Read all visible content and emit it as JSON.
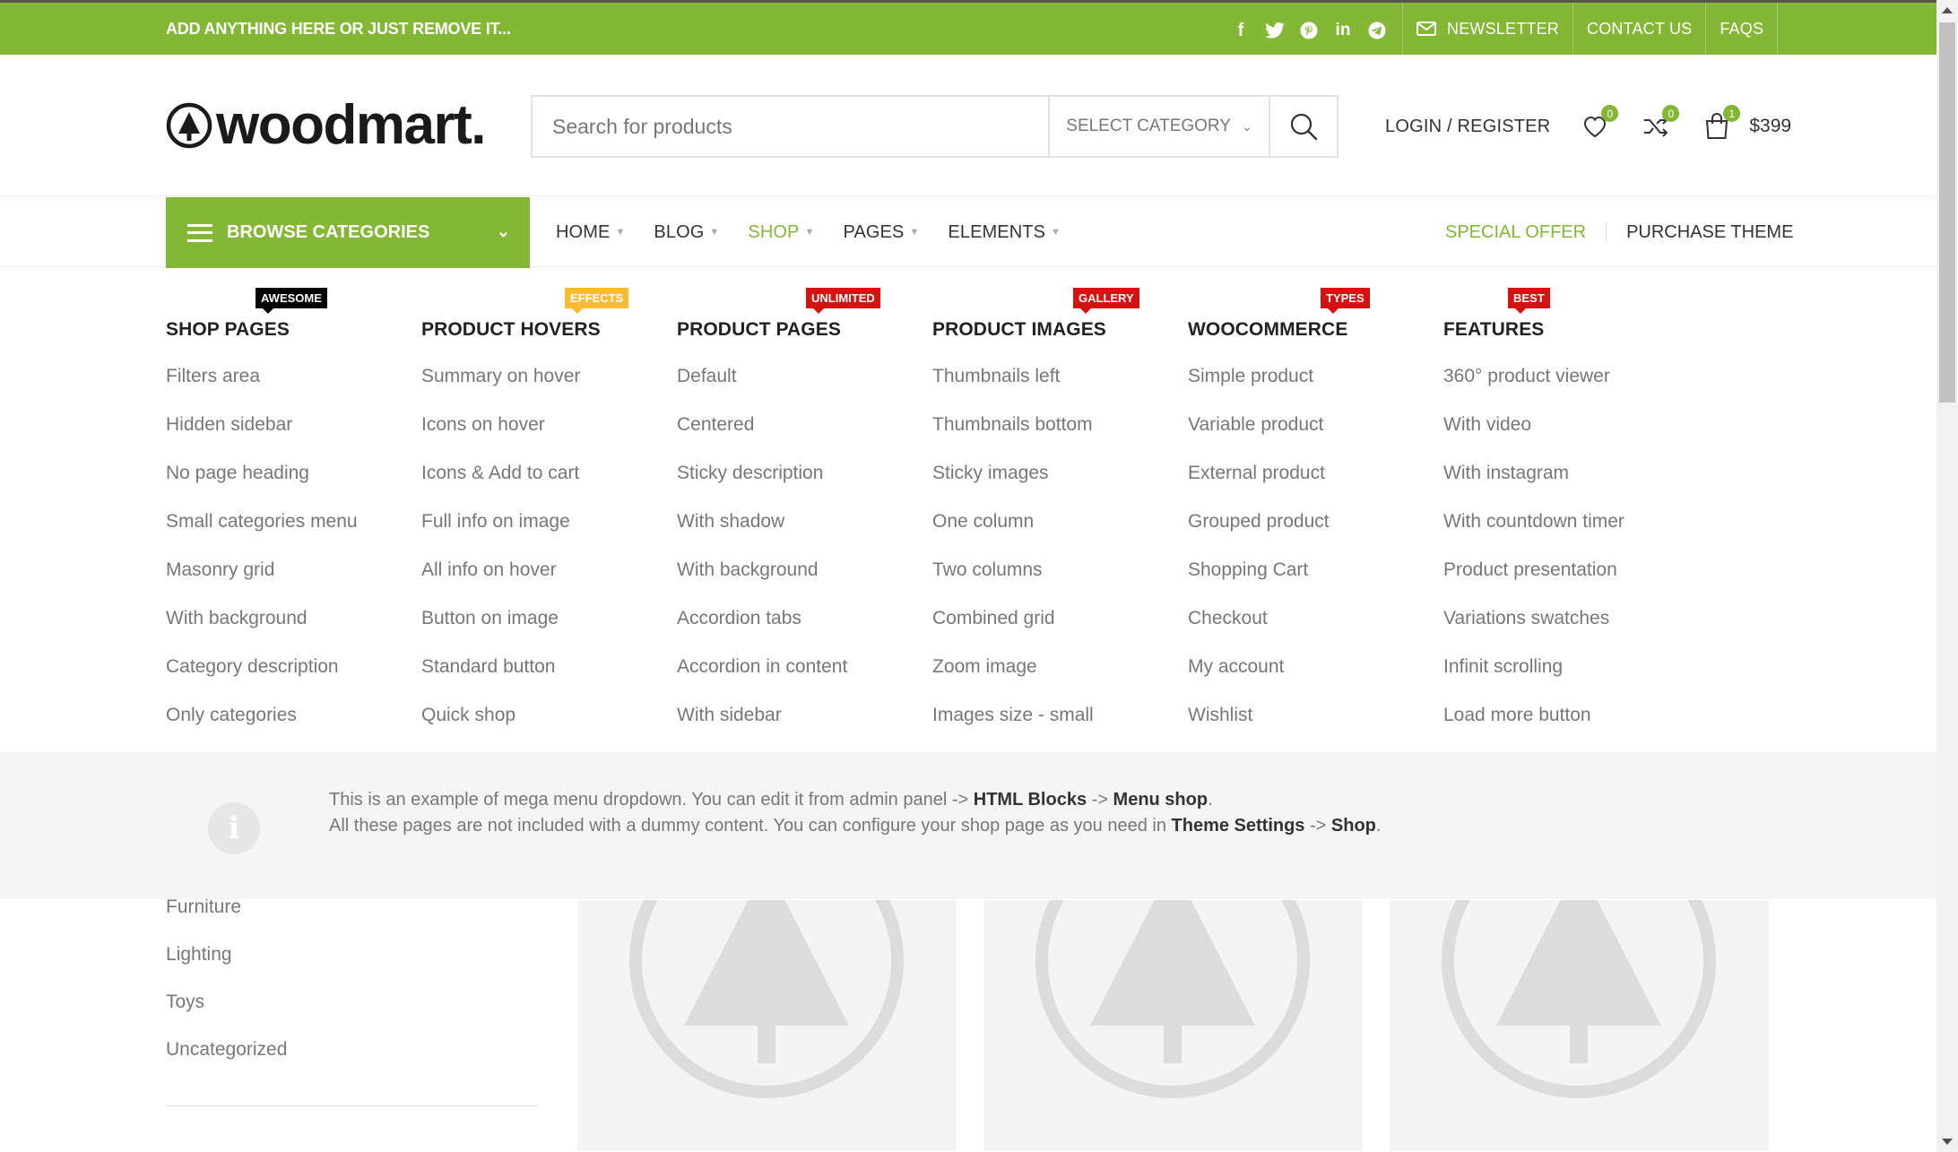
{
  "topbar": {
    "promo": "ADD ANYTHING HERE OR JUST REMOVE IT...",
    "social_icons": [
      "facebook-icon",
      "twitter-icon",
      "pinterest-icon",
      "linkedin-icon",
      "telegram-icon"
    ],
    "newsletter": "NEWSLETTER",
    "contact": "CONTACT US",
    "faqs": "FAQS"
  },
  "header": {
    "logo": "woodmart.",
    "search_placeholder": "Search for products",
    "select_category": "SELECT CATEGORY",
    "login": "LOGIN / REGISTER",
    "wishlist_count": "0",
    "compare_count": "0",
    "cart_count": "1",
    "cart_total": "$399"
  },
  "nav": {
    "browse": "BROWSE CATEGORIES",
    "items": [
      "HOME",
      "BLOG",
      "SHOP",
      "PAGES",
      "ELEMENTS"
    ],
    "active": "SHOP",
    "special": "SPECIAL OFFER",
    "purchase": "PURCHASE THEME"
  },
  "mega": {
    "columns": [
      {
        "title": "SHOP PAGES",
        "badge": "AWESOME",
        "badge_color": "#000000",
        "items": [
          "Filters area",
          "Hidden sidebar",
          "No page heading",
          "Small categories menu",
          "Masonry grid",
          "With background",
          "Category description",
          "Only categories"
        ]
      },
      {
        "title": "PRODUCT HOVERS",
        "badge": "EFFECTS",
        "badge_color": "#fbbc34",
        "items": [
          "Summary on hover",
          "Icons on hover",
          "Icons & Add to cart",
          "Full info on image",
          "All info on hover",
          "Button on image",
          "Standard button",
          "Quick shop"
        ]
      },
      {
        "title": "PRODUCT PAGES",
        "badge": "UNLIMITED",
        "badge_color": "#d41212",
        "items": [
          "Default",
          "Centered",
          "Sticky description",
          "With shadow",
          "With background",
          "Accordion tabs",
          "Accordion in content",
          "With sidebar"
        ]
      },
      {
        "title": "PRODUCT IMAGES",
        "badge": "GALLERY",
        "badge_color": "#d41212",
        "items": [
          "Thumbnails left",
          "Thumbnails bottom",
          "Sticky images",
          "One column",
          "Two columns",
          "Combined grid",
          "Zoom image",
          "Images size - small"
        ]
      },
      {
        "title": "WOOCOMMERCE",
        "badge": "TYPES",
        "badge_color": "#d41212",
        "items": [
          "Simple product",
          "Variable product",
          "External product",
          "Grouped product",
          "Shopping Cart",
          "Checkout",
          "My account",
          "Wishlist"
        ]
      },
      {
        "title": "FEATURES",
        "badge": "BEST",
        "badge_color": "#d41212",
        "items": [
          "360° product viewer",
          "With video",
          "With instagram",
          "With countdown timer",
          "Product presentation",
          "Variations swatches",
          "Infinit scrolling",
          "Load more button"
        ]
      }
    ],
    "info": {
      "l1_a": "This is an example of mega menu dropdown. You can edit it from admin panel -> ",
      "l1_b": "HTML Blocks",
      "l1_c": " -> ",
      "l1_d": "Menu shop",
      "l1_e": ".",
      "l2_a": "All these pages are not included with a dummy content. You can configure your shop page as you need in ",
      "l2_b": "Theme Settings",
      "l2_c": " -> ",
      "l2_d": "Shop",
      "l2_e": "."
    }
  },
  "sidebar_categories": [
    "Furniture",
    "Lighting",
    "Toys",
    "Uncategorized"
  ],
  "colors": {
    "accent": "#83b735",
    "text": "#333333",
    "muted": "#777777"
  }
}
